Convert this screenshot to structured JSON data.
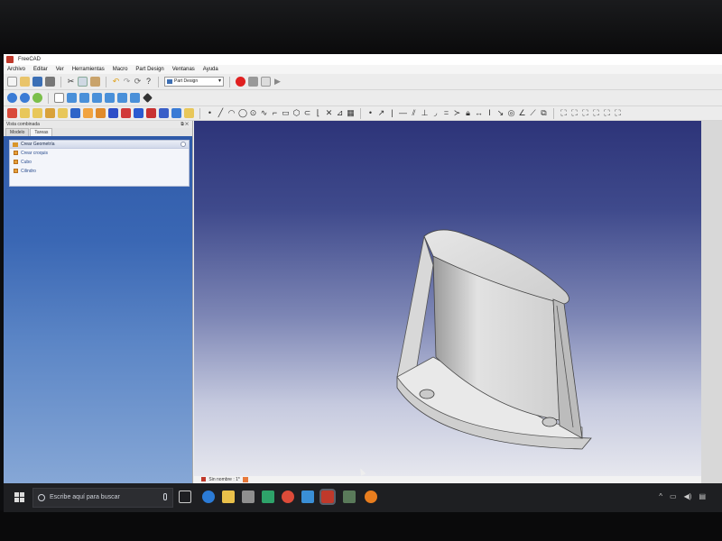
{
  "window": {
    "title": "FreeCAD"
  },
  "menu": [
    "Archivo",
    "Editar",
    "Ver",
    "Herramientas",
    "Macro",
    "Part Design",
    "Ventanas",
    "Ayuda"
  ],
  "toolbar": {
    "workbench": "Part Design"
  },
  "panel": {
    "title": "Vista combinada",
    "tabs": [
      "Modelo",
      "Tareas"
    ],
    "active_tab": "Tareas",
    "task_group": "Crear Geometría",
    "task_items": [
      "Crear croquis",
      "Cubo",
      "Cilindro"
    ]
  },
  "view": {
    "document_tab": "Sin nombre : 1*"
  },
  "taskbar": {
    "search_placeholder": "Escribe aquí para buscar"
  },
  "colors": {
    "view_top": "#2d3479",
    "view_bottom": "#e6e7ee",
    "panel_bg": "#3a67b4",
    "taskbar": "#1e1f22",
    "record_button": "#e02020"
  },
  "icons": [
    "new-file-icon",
    "open-icon",
    "save-icon",
    "print-icon",
    "cut-icon",
    "copy-icon",
    "paste-icon",
    "undo-icon",
    "redo-icon",
    "refresh-icon",
    "whats-this-icon",
    "record-macro-icon",
    "stop-macro-icon",
    "edit-macro-icon",
    "run-macro-icon",
    "fit-all-icon",
    "fit-selection-icon",
    "draw-style-icon",
    "isometric-view-icon",
    "front-view-icon",
    "top-view-icon",
    "right-view-icon",
    "rear-view-icon",
    "bottom-view-icon",
    "left-view-icon",
    "measure-icon"
  ]
}
